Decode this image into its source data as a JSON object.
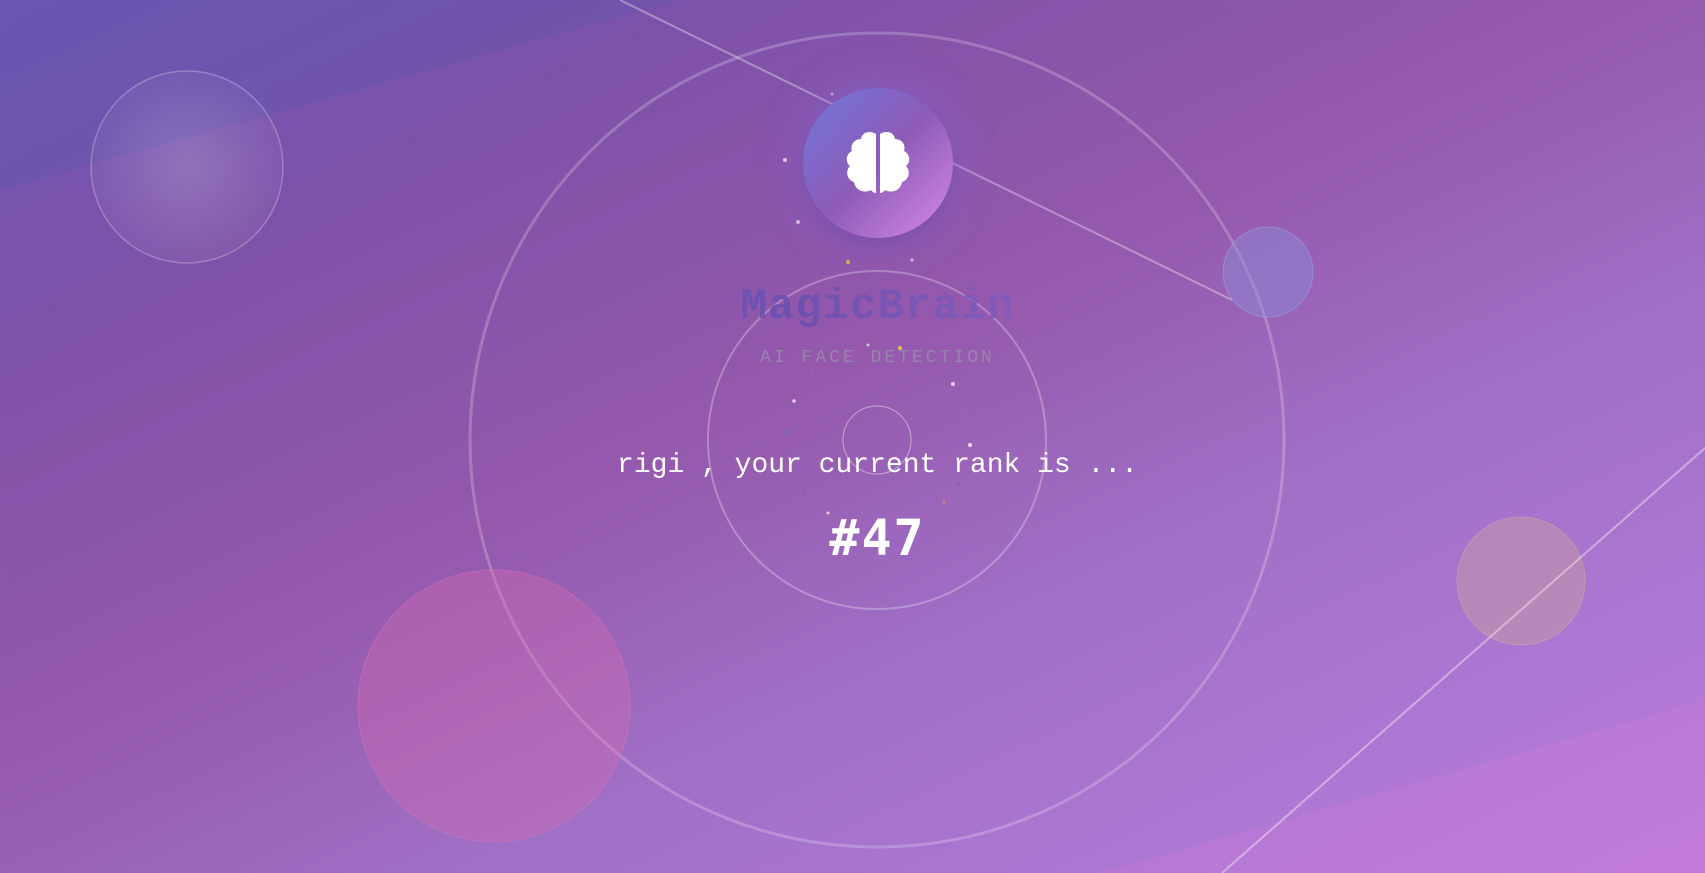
{
  "brand": {
    "title": "MagicBrain",
    "subtitle": "AI FACE DETECTION",
    "logo_icon": "brain-icon"
  },
  "rank": {
    "message": "rigi , your current rank is ...",
    "value": "#47"
  },
  "colors": {
    "background_start": "#6e58b4",
    "background_end": "#c27ada",
    "logo_gradient_start": "#6f78dc",
    "logo_gradient_end": "#d98ae8",
    "text": "#ffffff",
    "subtitle": "#968caa"
  }
}
